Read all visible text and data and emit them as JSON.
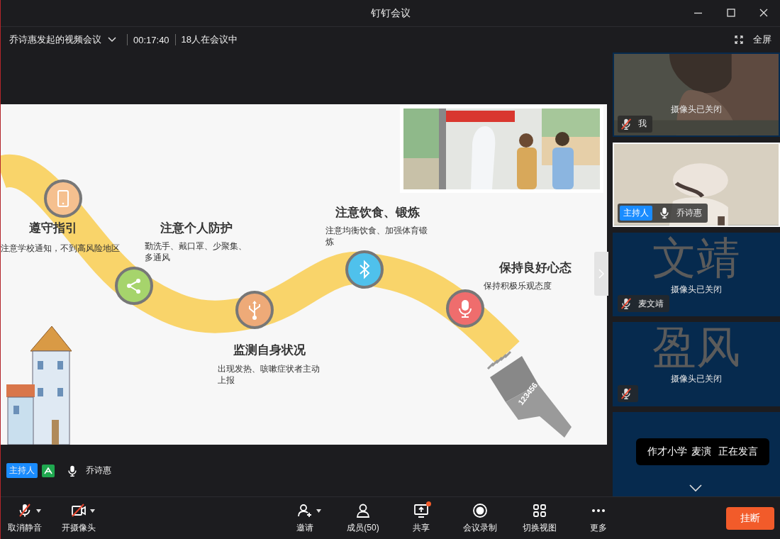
{
  "window": {
    "title": "钉钉会议"
  },
  "meeting_bar": {
    "title": "乔诗惠发起的视频会议",
    "duration": "00:17:40",
    "participants": "18人在会议中",
    "fullscreen": "全屏"
  },
  "slide": {
    "steps": [
      {
        "title": "遵守指引",
        "text": "注意学校通知，不到高风险地区",
        "kind": "phone",
        "color": "#f5c08f"
      },
      {
        "title": "注意个人防护",
        "text": "勤洗手、戴口罩、少聚集、多通风",
        "kind": "share",
        "color": "#a6d46c"
      },
      {
        "title": "监测自身状况",
        "text": "出现发热、咳嗽症状者主动上报",
        "kind": "usb",
        "color": "#eeaa78"
      },
      {
        "title": "注意饮食、锻炼",
        "text": "注意均衡饮食、加强体育锻炼",
        "kind": "bluetooth",
        "color": "#4fc1ec"
      },
      {
        "title": "保持良好心态",
        "text": "保持积极乐观态度",
        "kind": "mic",
        "color": "#ef6d6d"
      }
    ],
    "barcode": "123456"
  },
  "stage_label": {
    "badge": "主持人",
    "name": "乔诗惠",
    "muted": false
  },
  "tiles": [
    {
      "kind": "picture",
      "status": "摄像头已关闭",
      "name": "我",
      "muted": true,
      "selected": false
    },
    {
      "kind": "picture",
      "badge": "主持人",
      "name": "乔诗惠",
      "muted": false,
      "selected": true
    },
    {
      "kind": "avatar",
      "avatar_text": "文靖",
      "status": "摄像头已关闭",
      "name": "麦文靖",
      "muted": true,
      "selected": false
    },
    {
      "kind": "avatar",
      "avatar_text": "盈风",
      "status": "摄像头已关闭",
      "muted": true,
      "selected": false
    },
    {
      "kind": "avatar",
      "selected": false
    }
  ],
  "toast": {
    "school": "作才小学",
    "name": "麦演",
    "status": "正在发言"
  },
  "toolbar": {
    "left": [
      {
        "label": "取消静音",
        "kind": "mic-off",
        "dropdown": true
      },
      {
        "label": "开摄像头",
        "kind": "camera-off",
        "dropdown": true
      }
    ],
    "center": [
      {
        "label": "邀请",
        "kind": "add-user",
        "dropdown": true
      },
      {
        "label": "成员(50)",
        "kind": "user"
      },
      {
        "label": "共享",
        "kind": "share-screen",
        "dot": true
      },
      {
        "label": "会议录制",
        "kind": "record"
      },
      {
        "label": "切换视图",
        "kind": "grid"
      },
      {
        "label": "更多",
        "kind": "more"
      }
    ],
    "hangup": "挂断"
  }
}
